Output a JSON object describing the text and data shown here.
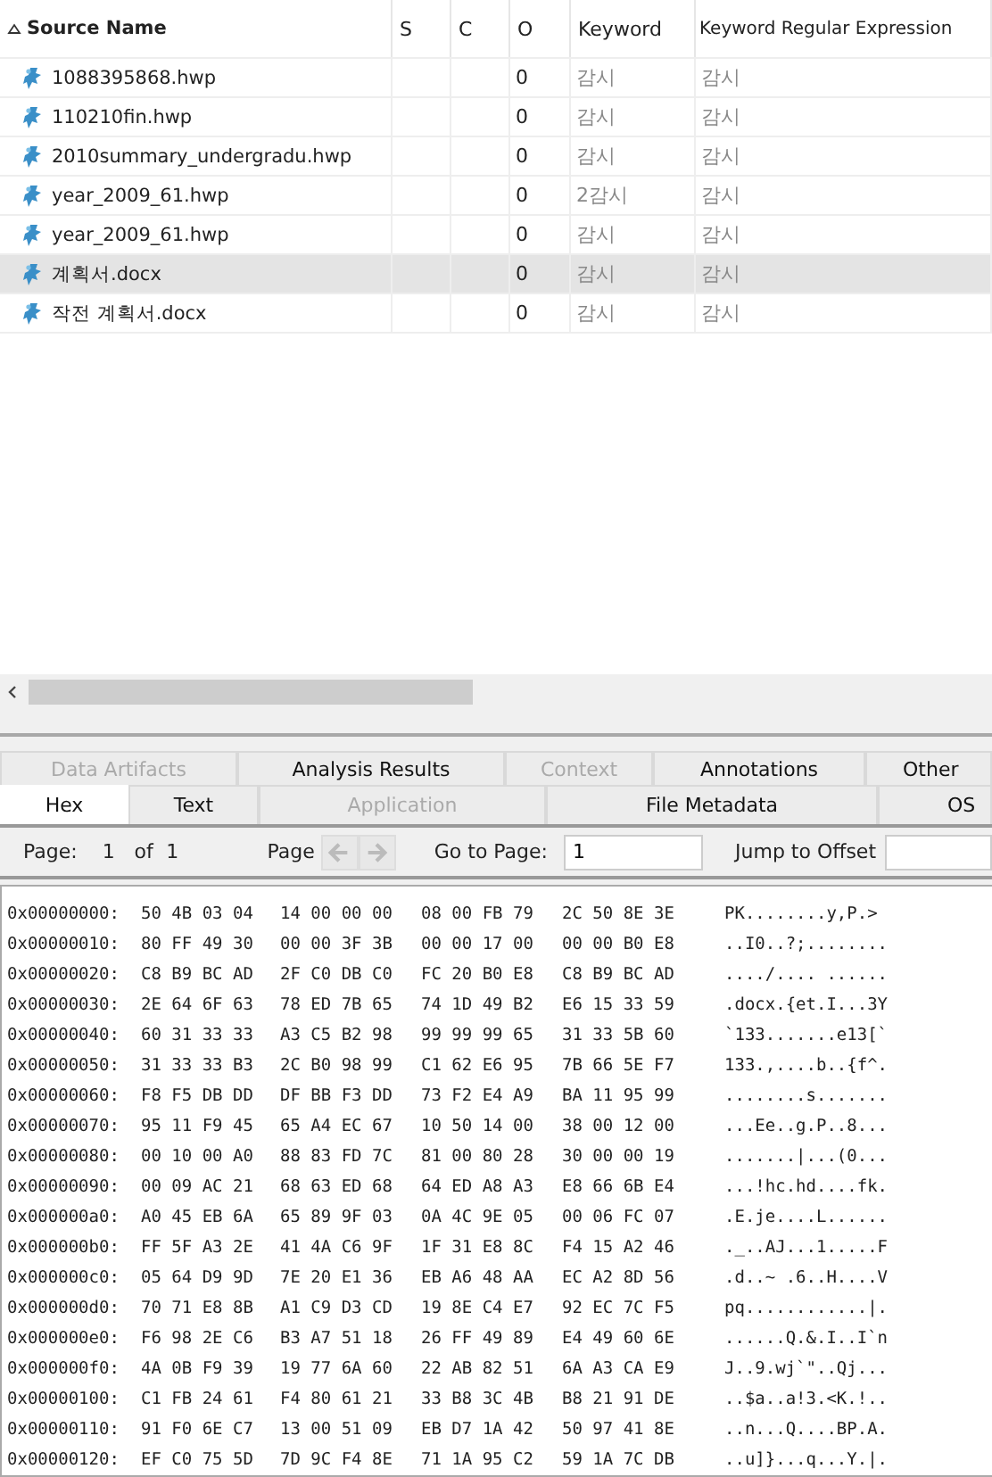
{
  "table": {
    "columns": [
      {
        "label": "Source Name",
        "sorted": true
      },
      {
        "label": "S",
        "sorted": false
      },
      {
        "label": "C",
        "sorted": false
      },
      {
        "label": "O",
        "sorted": false
      },
      {
        "label": "Keyword",
        "sorted": false
      },
      {
        "label": "Keyword Regular Expression",
        "sorted": false
      }
    ],
    "rows": [
      {
        "name": "1088395868.hwp",
        "o": "0",
        "keyword": "감시",
        "regex": "감시",
        "selected": false
      },
      {
        "name": "110210fin.hwp",
        "o": "0",
        "keyword": "감시",
        "regex": "감시",
        "selected": false
      },
      {
        "name": "2010summary_undergradu.hwp",
        "o": "0",
        "keyword": "감시",
        "regex": "감시",
        "selected": false
      },
      {
        "name": "year_2009_61.hwp",
        "o": "0",
        "keyword": "2감시",
        "regex": "감시",
        "selected": false
      },
      {
        "name": "year_2009_61.hwp",
        "o": "0",
        "keyword": "감시",
        "regex": "감시",
        "selected": false
      },
      {
        "name": "계획서.docx",
        "o": "0",
        "keyword": "감시",
        "regex": "감시",
        "selected": true
      },
      {
        "name": "작전 계획서.docx",
        "o": "0",
        "keyword": "감시",
        "regex": "감시",
        "selected": false
      }
    ]
  },
  "tabs_row_1": [
    {
      "label": "Data Artifacts",
      "disabled": true
    },
    {
      "label": "Analysis Results",
      "disabled": false
    },
    {
      "label": "Context",
      "disabled": true
    },
    {
      "label": "Annotations",
      "disabled": false
    },
    {
      "label": "Other",
      "disabled": false
    }
  ],
  "tabs_row_2": [
    {
      "label": "Hex",
      "selected": true,
      "disabled": false
    },
    {
      "label": "Text",
      "selected": false,
      "disabled": false
    },
    {
      "label": "Application",
      "selected": false,
      "disabled": true
    },
    {
      "label": "File Metadata",
      "selected": false,
      "disabled": false
    },
    {
      "label": "OS",
      "selected": false,
      "disabled": false
    }
  ],
  "toolbar": {
    "page_label": "Page:",
    "page": "1",
    "of_label": "of",
    "page_count": "1",
    "page_nav_label": "Page",
    "prev_disabled": true,
    "next_disabled": true,
    "go_to_label": "Go to Page:",
    "go_to_value": "1",
    "jump_label": "Jump to Offset"
  },
  "hex_rows": [
    {
      "offset": "0x00000000:",
      "groups": [
        "50 4B 03 04",
        "14 00 00 00",
        "08 00 FB 79",
        "2C 50 8E 3E"
      ],
      "ascii": "PK........y,P.>"
    },
    {
      "offset": "0x00000010:",
      "groups": [
        "80 FF 49 30",
        "00 00 3F 3B",
        "00 00 17 00",
        "00 00 B0 E8"
      ],
      "ascii": "..I0..?;........"
    },
    {
      "offset": "0x00000020:",
      "groups": [
        "C8 B9 BC AD",
        "2F C0 DB C0",
        "FC 20 B0 E8",
        "C8 B9 BC AD"
      ],
      "ascii": "..../.... ......"
    },
    {
      "offset": "0x00000030:",
      "groups": [
        "2E 64 6F 63",
        "78 ED 7B 65",
        "74 1D 49 B2",
        "E6 15 33 59"
      ],
      "ascii": ".docx.{et.I...3Y"
    },
    {
      "offset": "0x00000040:",
      "groups": [
        "60 31 33 33",
        "A3 C5 B2 98",
        "99 99 99 65",
        "31 33 5B 60"
      ],
      "ascii": "`133.......e13[`"
    },
    {
      "offset": "0x00000050:",
      "groups": [
        "31 33 33 B3",
        "2C B0 98 99",
        "C1 62 E6 95",
        "7B 66 5E F7"
      ],
      "ascii": "133.,....b..{f^."
    },
    {
      "offset": "0x00000060:",
      "groups": [
        "F8 F5 DB DD",
        "DF BB F3 DD",
        "73 F2 E4 A9",
        "BA 11 95 99"
      ],
      "ascii": "........s......."
    },
    {
      "offset": "0x00000070:",
      "groups": [
        "95 11 F9 45",
        "65 A4 EC 67",
        "10 50 14 00",
        "38 00 12 00"
      ],
      "ascii": "...Ee..g.P..8..."
    },
    {
      "offset": "0x00000080:",
      "groups": [
        "00 10 00 A0",
        "88 83 FD 7C",
        "81 00 80 28",
        "30 00 00 19"
      ],
      "ascii": ".......|...(0..."
    },
    {
      "offset": "0x00000090:",
      "groups": [
        "00 09 AC 21",
        "68 63 ED 68",
        "64 ED A8 A3",
        "E8 66 6B E4"
      ],
      "ascii": "...!hc.hd....fk."
    },
    {
      "offset": "0x000000a0:",
      "groups": [
        "A0 45 EB 6A",
        "65 89 9F 03",
        "0A 4C 9E 05",
        "00 06 FC 07"
      ],
      "ascii": ".E.je....L......"
    },
    {
      "offset": "0x000000b0:",
      "groups": [
        "FF 5F A3 2E",
        "41 4A C6 9F",
        "1F 31 E8 8C",
        "F4 15 A2 46"
      ],
      "ascii": "._..AJ...1.....F"
    },
    {
      "offset": "0x000000c0:",
      "groups": [
        "05 64 D9 9D",
        "7E 20 E1 36",
        "EB A6 48 AA",
        "EC A2 8D 56"
      ],
      "ascii": ".d..~ .6..H....V"
    },
    {
      "offset": "0x000000d0:",
      "groups": [
        "70 71 E8 8B",
        "A1 C9 D3 CD",
        "19 8E C4 E7",
        "92 EC 7C F5"
      ],
      "ascii": "pq............|."
    },
    {
      "offset": "0x000000e0:",
      "groups": [
        "F6 98 2E C6",
        "B3 A7 51 18",
        "26 FF 49 89",
        "E4 49 60 6E"
      ],
      "ascii": "......Q.&.I..I`n"
    },
    {
      "offset": "0x000000f0:",
      "groups": [
        "4A 0B F9 39",
        "19 77 6A 60",
        "22 AB 82 51",
        "6A A3 CA E9"
      ],
      "ascii": "J..9.wj`\"..Qj..."
    },
    {
      "offset": "0x00000100:",
      "groups": [
        "C1 FB 24 61",
        "F4 80 61 21",
        "33 B8 3C 4B",
        "B8 21 91 DE"
      ],
      "ascii": "..$a..a!3.<K.!.."
    },
    {
      "offset": "0x00000110:",
      "groups": [
        "91 F0 6E C7",
        "13 00 51 09",
        "EB D7 1A 42",
        "50 97 41 8E"
      ],
      "ascii": "..n...Q....BP.A."
    },
    {
      "offset": "0x00000120:",
      "groups": [
        "EF C0 75 5D",
        "7D 9C F4 8E",
        "71 1A 95 C2",
        "59 1A 7C DB"
      ],
      "ascii": "..u]}...q...Y.|."
    }
  ]
}
